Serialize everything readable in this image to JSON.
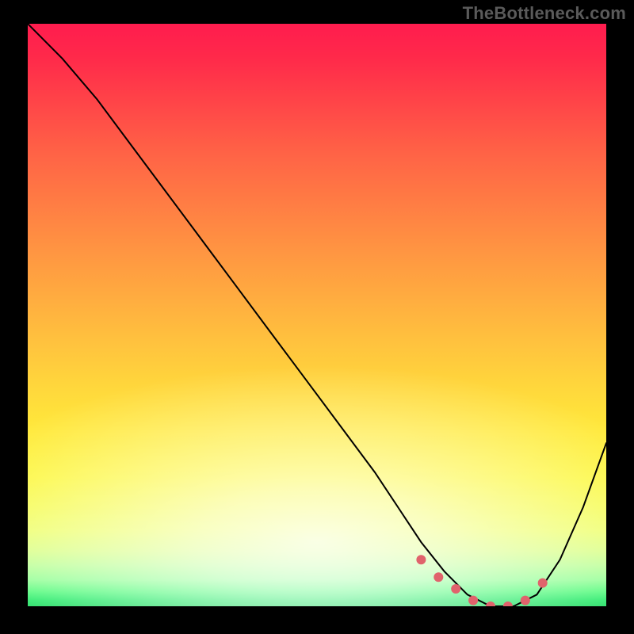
{
  "watermark": "TheBottleneck.com",
  "colors": {
    "curve": "#000000",
    "marker": "#e0636c",
    "frame": "#000000"
  },
  "chart_data": {
    "type": "line",
    "title": "",
    "xlabel": "",
    "ylabel": "",
    "xlim": [
      0,
      100
    ],
    "ylim": [
      0,
      100
    ],
    "grid": false,
    "legend": false,
    "series": [
      {
        "name": "bottleneck-curve",
        "x": [
          0,
          6,
          12,
          18,
          24,
          30,
          36,
          42,
          48,
          54,
          60,
          64,
          68,
          72,
          76,
          80,
          84,
          88,
          92,
          96,
          100
        ],
        "y": [
          100,
          94,
          87,
          79,
          71,
          63,
          55,
          47,
          39,
          31,
          23,
          17,
          11,
          6,
          2,
          0,
          0,
          2,
          8,
          17,
          28
        ]
      }
    ],
    "markers": {
      "name": "optimal-range",
      "x": [
        68,
        71,
        74,
        77,
        80,
        83,
        86,
        89
      ],
      "y": [
        8,
        5,
        3,
        1,
        0,
        0,
        1,
        4
      ],
      "radius_px": 6
    }
  }
}
